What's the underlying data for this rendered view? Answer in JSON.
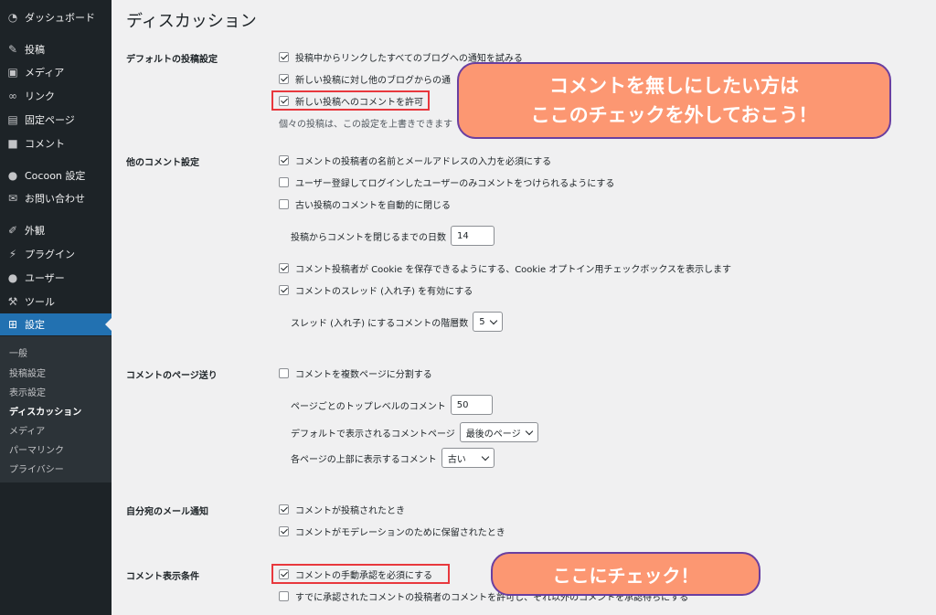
{
  "sidebar": {
    "items": [
      {
        "label": "ダッシュボード",
        "icon": "dashboard-icon"
      },
      {
        "label": "投稿",
        "icon": "pushpin-icon"
      },
      {
        "label": "メディア",
        "icon": "media-icon"
      },
      {
        "label": "リンク",
        "icon": "link-icon"
      },
      {
        "label": "固定ページ",
        "icon": "page-icon"
      },
      {
        "label": "コメント",
        "icon": "comment-icon"
      },
      {
        "label": "Cocoon 設定",
        "icon": "cocoon-icon"
      },
      {
        "label": "お問い合わせ",
        "icon": "mail-icon"
      },
      {
        "label": "外観",
        "icon": "brush-icon"
      },
      {
        "label": "プラグイン",
        "icon": "plugin-icon"
      },
      {
        "label": "ユーザー",
        "icon": "user-icon"
      },
      {
        "label": "ツール",
        "icon": "wrench-icon"
      },
      {
        "label": "設定",
        "icon": "settings-icon"
      }
    ],
    "submenu": [
      "一般",
      "投稿設定",
      "表示設定",
      "ディスカッション",
      "メディア",
      "パーマリンク",
      "プライバシー"
    ]
  },
  "page": {
    "title": "ディスカッション"
  },
  "sections": {
    "default_post": {
      "label": "デフォルトの投稿設定",
      "opt1": "投稿中からリンクしたすべてのブログへの通知を試みる",
      "opt2": "新しい投稿に対し他のブログからの通",
      "opt3": "新しい投稿へのコメントを許可",
      "desc": "個々の投稿は、この設定を上書きできます"
    },
    "other_comment": {
      "label": "他のコメント設定",
      "opt1": "コメントの投稿者の名前とメールアドレスの入力を必須にする",
      "opt2": "ユーザー登録してログインしたユーザーのみコメントをつけられるようにする",
      "opt3": "古い投稿のコメントを自動的に閉じる",
      "days_label": "投稿からコメントを閉じるまでの日数",
      "days_value": "14",
      "opt4": "コメント投稿者が Cookie を保存できるようにする、Cookie オプトイン用チェックボックスを表示します",
      "opt5": "コメントのスレッド (入れ子) を有効にする",
      "depth_label": "スレッド (入れ子) にするコメントの階層数",
      "depth_value": "5"
    },
    "pagination": {
      "label": "コメントのページ送り",
      "opt1": "コメントを複数ページに分割する",
      "per_page_label": "ページごとのトップレベルのコメント",
      "per_page_value": "50",
      "default_page_label": "デフォルトで表示されるコメントページ",
      "default_page_value": "最後のページ",
      "top_label": "各ページの上部に表示するコメント",
      "top_value": "古い"
    },
    "email": {
      "label": "自分宛のメール通知",
      "opt1": "コメントが投稿されたとき",
      "opt2": "コメントがモデレーションのために保留されたとき"
    },
    "appear": {
      "label": "コメント表示条件",
      "opt1": "コメントの手動承認を必須にする",
      "opt2": "すでに承認されたコメントの投稿者のコメントを許可し、それ以外のコメントを承認待ちにする"
    }
  },
  "callouts": {
    "callout1_line1": "コメントを無しにしたい方は",
    "callout1_line2": "ここのチェックを外しておこう！",
    "callout2": "ここにチェック！"
  },
  "colors": {
    "sidebar_bg": "#1d2327",
    "active": "#2271b1",
    "callout_fill": "#fc9772",
    "callout_border": "#6a3fa0",
    "highlight": "#e8383d"
  }
}
